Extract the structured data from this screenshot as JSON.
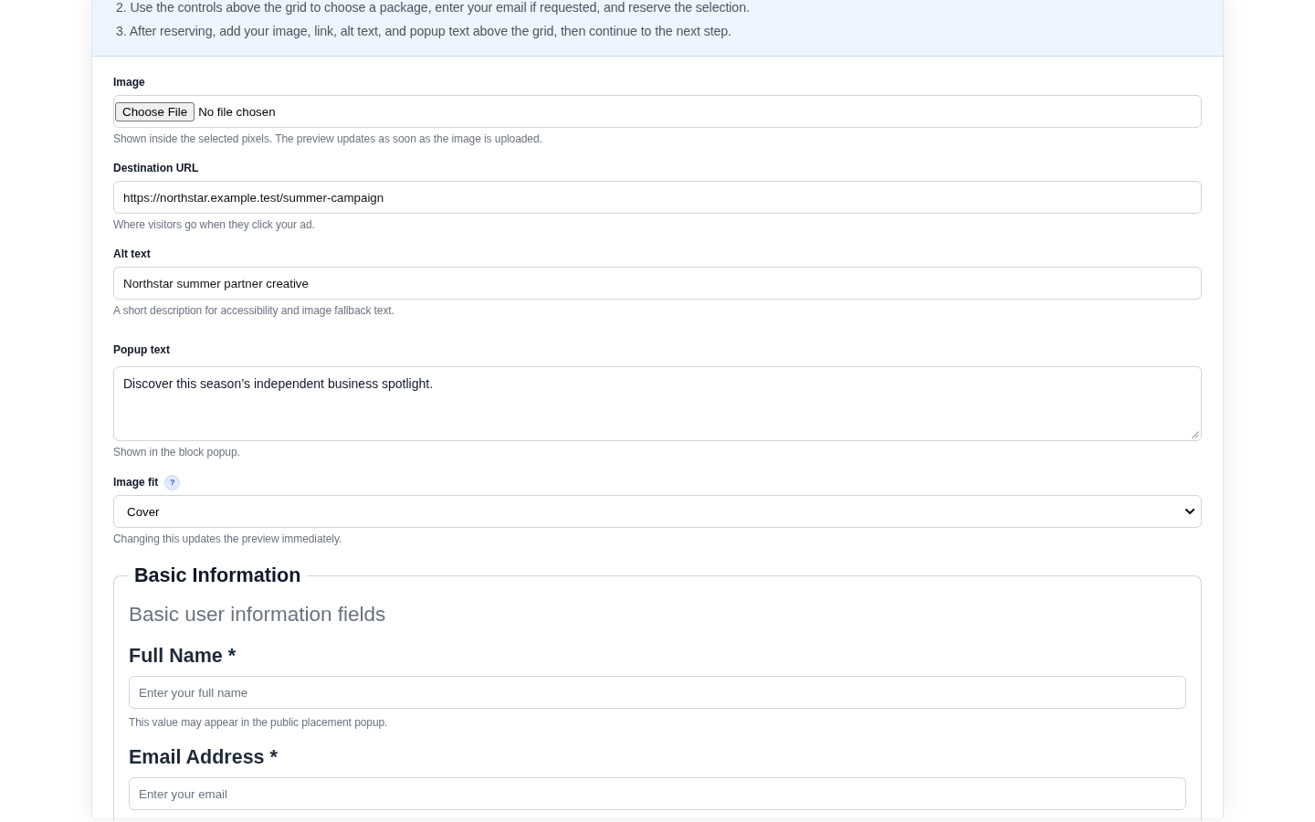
{
  "instructions": {
    "items": [
      "2. Use the controls above the grid to choose a package, enter your email if requested, and reserve the selection.",
      "3. After reserving, add your image, link, alt text, and popup text above the grid, then continue to the next step."
    ]
  },
  "form": {
    "fields": [
      {
        "kind": "file",
        "label": "Image",
        "button": "Choose File",
        "status": "No file chosen",
        "hint": "Shown inside the selected pixels. The preview updates as soon as the image is uploaded."
      },
      {
        "kind": "text",
        "label": "Destination URL",
        "value": "https://northstar.example.test/summer-campaign",
        "hint": "Where visitors go when they click your ad."
      },
      {
        "kind": "text",
        "label": "Alt text",
        "value": "Northstar summer partner creative",
        "hint": "A short description for accessibility and image fallback text."
      },
      {
        "kind": "textarea",
        "label": "Popup text",
        "value": "Discover this season’s independent business spotlight.",
        "hint": "Shown in the block popup."
      },
      {
        "kind": "select",
        "label": "Image fit",
        "help": "?",
        "value": "Cover",
        "hint": "Changing this updates the preview immediately."
      }
    ]
  },
  "fieldset": {
    "legend": "Basic Information",
    "description": "Basic user information fields",
    "fields": [
      {
        "label": "Full Name *",
        "placeholder": "Enter your full name",
        "hint": "This value may appear in the public placement popup."
      },
      {
        "label": "Email Address *",
        "placeholder": "Enter your email"
      }
    ]
  }
}
